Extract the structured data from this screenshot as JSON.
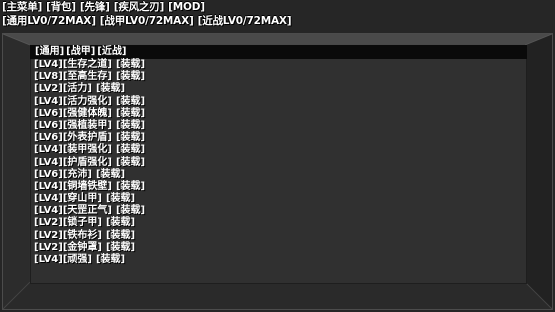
{
  "top_menu": [
    "[主菜单]",
    "[背包]",
    "[先锋]",
    "[疾风之刃]",
    "[MOD]"
  ],
  "level_bar": [
    "[通用LV0/72MAX]",
    "[战甲LV0/72MAX]",
    "[近战LV0/72MAX]"
  ],
  "panel": {
    "tabs": [
      "[通用]",
      "[战甲]",
      "[近战]"
    ],
    "equip_label": "[装载]",
    "skills": [
      "[LV4][生存之道]",
      "[LV8][至高生存]",
      "[LV2][活力]",
      "[LV4][活力强化]",
      "[LV6][强健体魄]",
      "[LV6][强植装甲]",
      "[LV6][外表护盾]",
      "[LV4][装甲强化]",
      "[LV4][护盾强化]",
      "[LV6][充沛]",
      "[LV4][铜墙铁壁]",
      "[LV4][穿山甲]",
      "[LV4][天罡正气]",
      "[LV2][锁子甲]",
      "[LV2][铁布衫]",
      "[LV2][金钟罩]",
      "[LV4][顽强]"
    ]
  }
}
